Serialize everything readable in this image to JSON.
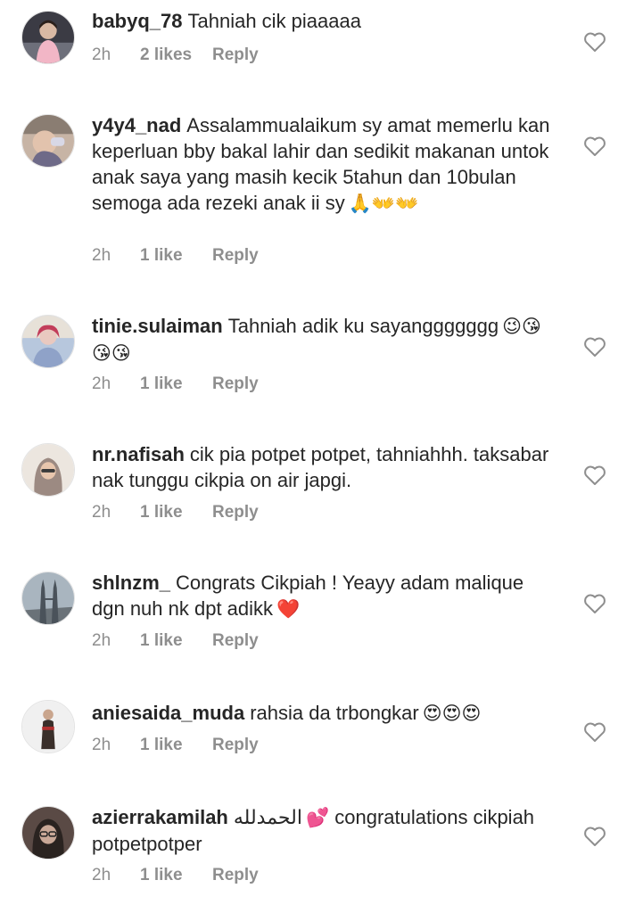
{
  "comments": [
    {
      "username": "babyq_78",
      "text": "Tahniah cik piaaaaa",
      "emojis": "",
      "time": "2h",
      "likes": "2 likes",
      "reply": "Reply",
      "avatar_icon": "child-photo",
      "avatar_colors": [
        "#d9b9a4",
        "#3b3b44"
      ]
    },
    {
      "username": "y4y4_nad",
      "text": "Assalammualaikum sy amat memerlu kan keperluan bby bakal lahir dan sedikit makanan untok anak saya yang masih kecik 5tahun dan 10bulan semoga ada rezeki anak ii sy",
      "emojis": "🙏👐👐",
      "time": "2h",
      "likes": "1 like",
      "reply": "Reply",
      "avatar_icon": "baby-photo",
      "avatar_colors": [
        "#c7b4a5",
        "#6e6a88"
      ]
    },
    {
      "username": "tinie.sulaiman",
      "text": "Tahniah adik ku sayanggggggg",
      "emojis": "😉😘😘😘",
      "time": "2h",
      "likes": "1 like",
      "reply": "Reply",
      "avatar_icon": "woman-photo",
      "avatar_colors": [
        "#e9c9c0",
        "#8fa2c8"
      ]
    },
    {
      "username": "nr.nafisah",
      "text": "cik pia potpet potpet, tahniahhh. taksabar nak tunggu cikpia on air japgi.",
      "emojis": "",
      "time": "2h",
      "likes": "1 like",
      "reply": "Reply",
      "avatar_icon": "hijab-woman-photo",
      "avatar_colors": [
        "#ece6df",
        "#9c8a82"
      ]
    },
    {
      "username": "shlnzm_",
      "text": "Congrats Cikpiah ! Yeayy adam malique dgn nuh nk dpt adikk",
      "emojis": "❤️",
      "time": "2h",
      "likes": "1 like",
      "reply": "Reply",
      "avatar_icon": "towers-photo",
      "avatar_colors": [
        "#a9b5bf",
        "#4a525a"
      ]
    },
    {
      "username": "aniesaida_muda",
      "text": "rahsia da trbongkar",
      "emojis": "😍😍😍",
      "time": "2h",
      "likes": "1 like",
      "reply": "Reply",
      "avatar_icon": "figure-photo",
      "avatar_colors": [
        "#f0f0f0",
        "#3a2f2a"
      ]
    },
    {
      "username": "azierrakamilah",
      "text": "الحمدلله",
      "emojis": "💕",
      "text2": "congratulations cikpiah potpetpotper",
      "time": "2h",
      "likes": "1 like",
      "reply": "Reply",
      "avatar_icon": "woman-glasses-photo",
      "avatar_colors": [
        "#5a4a45",
        "#c9a897"
      ]
    }
  ]
}
